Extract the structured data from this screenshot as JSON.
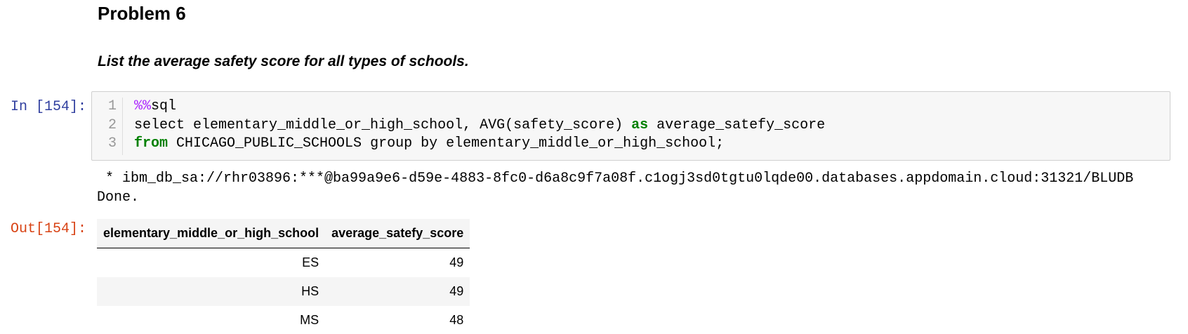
{
  "markdown": {
    "heading": "Problem 6",
    "subtitle": "List the average safety score for all types of schools."
  },
  "cell": {
    "in_prompt": "In [154]:",
    "out_prompt": "Out[154]:",
    "code_lines": [
      {
        "num": "1",
        "segments": [
          {
            "text": "%%",
            "kind": "magic"
          },
          {
            "text": "sql",
            "kind": "plain"
          }
        ]
      },
      {
        "num": "2",
        "segments": [
          {
            "text": "select elementary_middle_or_high_school, AVG(safety_score) ",
            "kind": "plain"
          },
          {
            "text": "as",
            "kind": "kw"
          },
          {
            "text": " average_satefy_score",
            "kind": "plain"
          }
        ]
      },
      {
        "num": "3",
        "segments": [
          {
            "text": "from",
            "kind": "kw"
          },
          {
            "text": " CHICAGO_PUBLIC_SCHOOLS group by elementary_middle_or_high_school;",
            "kind": "plain"
          }
        ]
      }
    ],
    "output_connection": " * ibm_db_sa://rhr03896:***@ba99a9e6-d59e-4883-8fc0-d6a8c9f7a08f.c1ogj3sd0tgtu0lqde00.databases.appdomain.cloud:31321/BLUDB",
    "output_done": "Done."
  },
  "table": {
    "columns": [
      "elementary_middle_or_high_school",
      "average_satefy_score"
    ],
    "rows": [
      [
        "ES",
        "49"
      ],
      [
        "HS",
        "49"
      ],
      [
        "MS",
        "48"
      ]
    ]
  }
}
